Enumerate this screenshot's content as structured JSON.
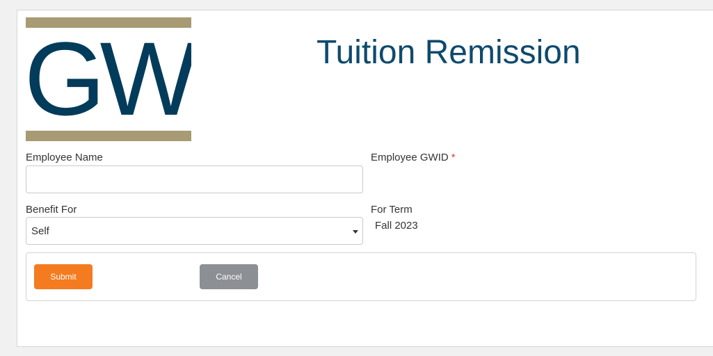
{
  "logo": {
    "text": "GW"
  },
  "header": {
    "title": "Tuition Remission"
  },
  "form": {
    "employee_name": {
      "label": "Employee Name",
      "value": "",
      "placeholder": ""
    },
    "employee_gwid": {
      "label": "Employee GWID",
      "required_marker": "*"
    },
    "benefit_for": {
      "label": "Benefit For",
      "selected": "Self"
    },
    "for_term": {
      "label": "For Term",
      "value": "Fall 2023"
    }
  },
  "actions": {
    "submit_label": "Submit",
    "cancel_label": "Cancel"
  },
  "colors": {
    "brand_navy": "#033c5a",
    "brand_gold": "#a89a72",
    "title_blue": "#0e4a6e",
    "submit_orange": "#f47b20",
    "cancel_gray": "#8c8f93",
    "required_red": "#d23c3c"
  },
  "icons": {
    "select_caret": "chevron-down-icon"
  }
}
